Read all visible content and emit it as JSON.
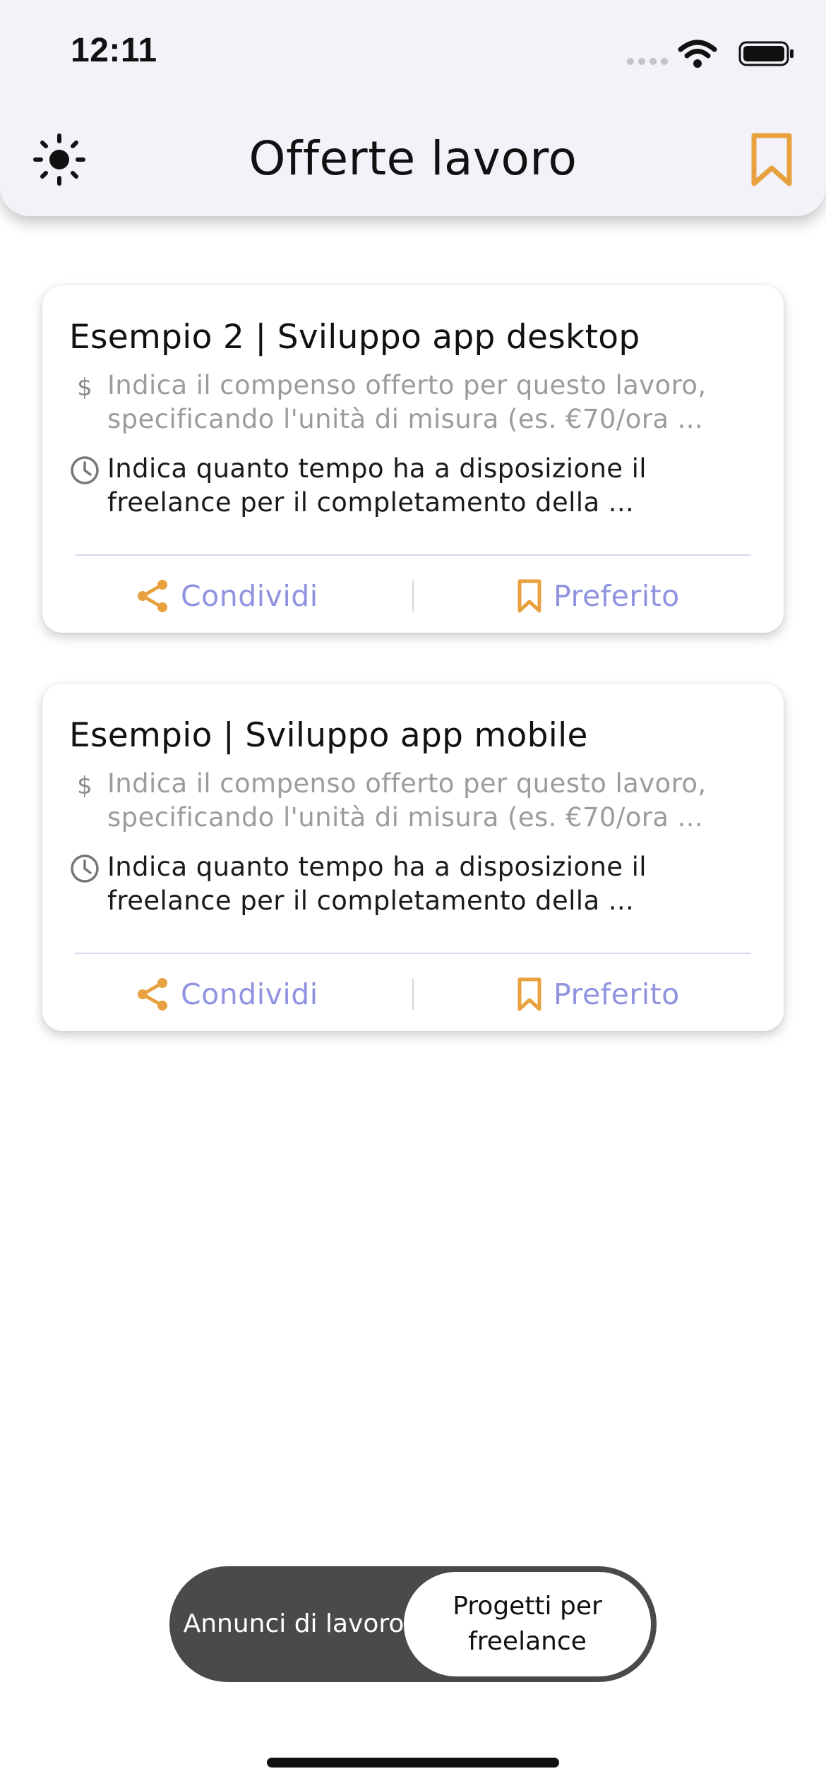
{
  "status_bar": {
    "time": "12:11"
  },
  "header": {
    "title": "Offerte lavoro"
  },
  "colors": {
    "accent_orange": "#e8a13f",
    "link_purple": "#8f93e0",
    "header_bg": "#f3f2f8",
    "toggle_dark": "#4a4a4a"
  },
  "icons": {
    "theme": "sun-icon",
    "bookmarks": "bookmark-icon",
    "compensation": "dollar-icon",
    "time": "clock-icon",
    "share": "share-icon",
    "favorite": "bookmark-icon"
  },
  "offers": [
    {
      "title": "Esempio 2 | Sviluppo app desktop",
      "compensation": "Indica il compenso offerto per questo lavoro, specificando l'unità di misura (es. €70/ora ...",
      "time": "Indica quanto tempo ha a disposizione il freelance per il completamento della ...",
      "share_label": "Condividi",
      "favorite_label": "Preferito"
    },
    {
      "title": "Esempio | Sviluppo app mobile",
      "compensation": "Indica il compenso offerto per questo lavoro, specificando l'unità di misura (es. €70/ora ...",
      "time": "Indica quanto tempo ha a disposizione il freelance per il completamento della ...",
      "share_label": "Condividi",
      "favorite_label": "Preferito"
    }
  ],
  "segmented_control": {
    "options": [
      "Annunci di lavoro",
      "Progetti per freelance"
    ],
    "selected": "Progetti per freelance"
  }
}
